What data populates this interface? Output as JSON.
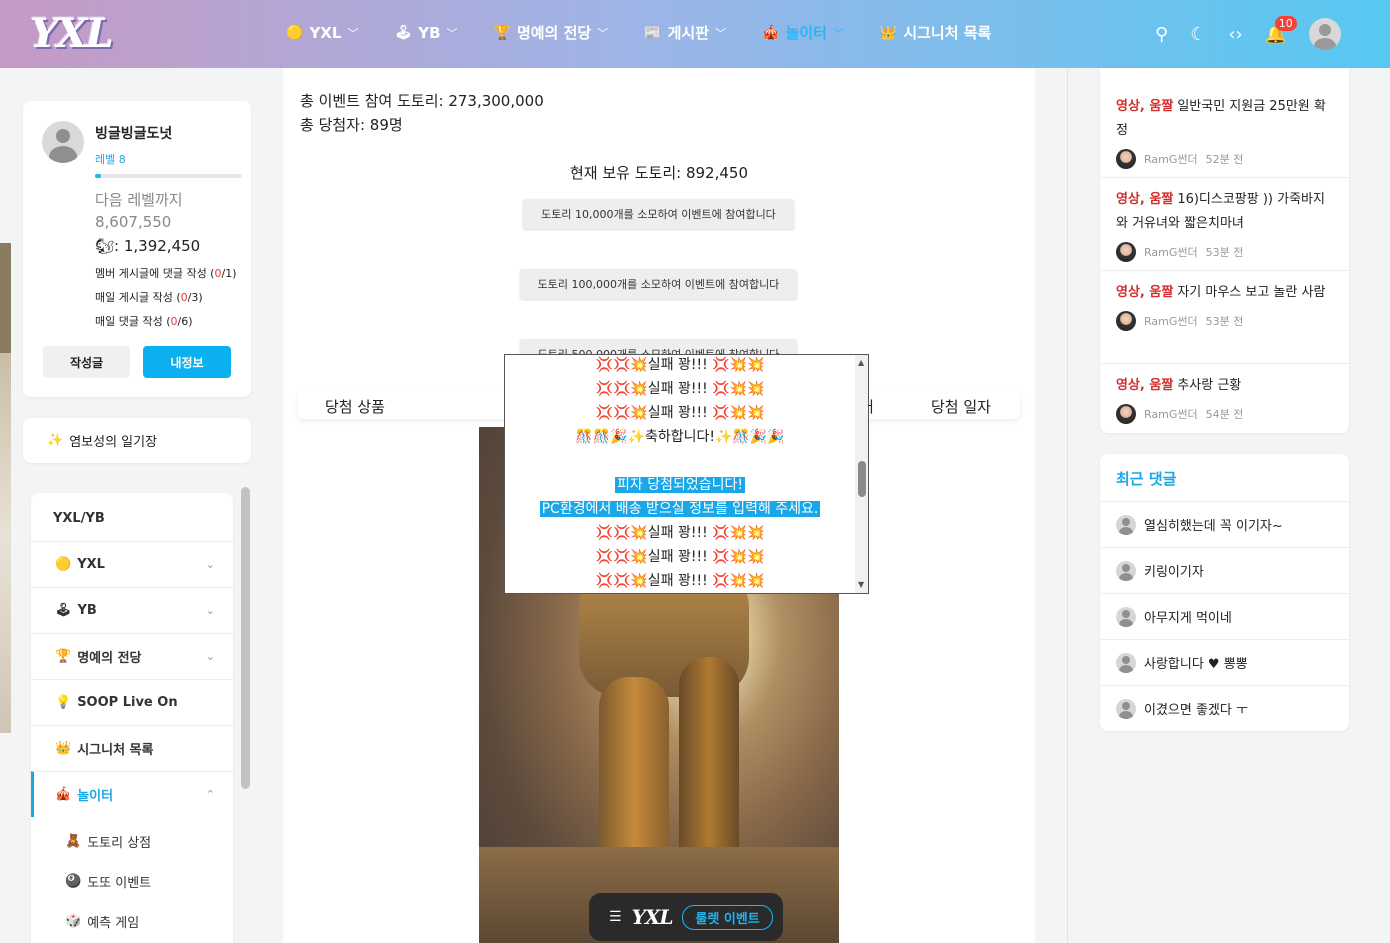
{
  "header": {
    "logo": "YXL",
    "nav": [
      {
        "icon": "🟡",
        "label": "YXL",
        "chevron": true,
        "active": false
      },
      {
        "icon": "🕹",
        "label": "YB",
        "chevron": true,
        "active": false
      },
      {
        "icon": "🏆",
        "label": "명예의 전당",
        "chevron": true,
        "active": false
      },
      {
        "icon": "📰",
        "label": "게시판",
        "chevron": true,
        "active": false
      },
      {
        "icon": "🎪",
        "label": "놀이터",
        "chevron": true,
        "active": true
      },
      {
        "icon": "👑",
        "label": "시그니처 목록",
        "chevron": false,
        "active": false
      }
    ],
    "icons": {
      "search": "⚲",
      "theme": "☾",
      "code": "‹›",
      "bell": "🔔",
      "avatar": "user-avatar"
    },
    "notification_count": "10"
  },
  "profile": {
    "name": "빙글빙글도넛",
    "level": "레벨 8",
    "progress": 0.04,
    "next_label": "다음 레벨까지",
    "next_value": "8,607,550",
    "acorn_icon": "🐿",
    "acorns": ": 1,392,450",
    "tasks": [
      {
        "label": "멤버 게시글에 댓글 작성 (",
        "value": "0",
        "total": "/1)"
      },
      {
        "label": "매일 게시글 작성 (",
        "value": "0",
        "total": "/3)"
      },
      {
        "label": "매일 댓글 작성 (",
        "value": "0",
        "total": "/6)"
      }
    ],
    "write_button": "작성글",
    "info_button": "내정보"
  },
  "diary": {
    "icon": "✨",
    "label": "염보성의 일기장"
  },
  "menu": {
    "heading": "YXL/YB",
    "items": [
      {
        "icon": "🟡",
        "label": "YXL",
        "chevron": "⌄",
        "active": false
      },
      {
        "icon": "🕹",
        "label": "YB",
        "chevron": "⌄",
        "active": false
      },
      {
        "icon": "🏆",
        "label": "명예의 전당",
        "chevron": "⌄",
        "active": false
      },
      {
        "icon": "💡",
        "label": "SOOP Live On",
        "chevron": "",
        "active": false
      },
      {
        "icon": "👑",
        "label": "시그니처 목록",
        "chevron": "",
        "active": false
      },
      {
        "icon": "🎪",
        "label": "놀이터",
        "chevron": "⌃",
        "active": true
      }
    ],
    "sub_items": [
      {
        "icon": "🧸",
        "label": "도토리 상점"
      },
      {
        "icon": "🎱",
        "label": "도또 이벤트"
      },
      {
        "icon": "🎲",
        "label": "예측 게임"
      }
    ]
  },
  "main": {
    "total_acorns": "총 이벤트 참여 도토리: 273,300,000",
    "total_winners": "총 당첨자: 89명",
    "current_acorns": "현재 보유 도토리: 892,450",
    "buttons": [
      "도토리 10,000개를 소모하여 이벤트에 참여합니다",
      "도토리 100,000개를 소모하여 이벤트에 참여합니다",
      "도토리 500,000개를 소모하여 이벤트에 참여합니다"
    ],
    "table_headers": [
      "당첨 상품",
      "상태",
      "당첨 일자"
    ],
    "popup_lines": [
      {
        "text": "💢💢💥실패 꽝!!! 💢💥💥",
        "highlight": false
      },
      {
        "text": "💢💢💥실패 꽝!!! 💢💥💥",
        "highlight": false
      },
      {
        "text": "💢💢💥실패 꽝!!! 💢💥💥",
        "highlight": false
      },
      {
        "text": "🎊🎊🎉✨축하합니다!✨🎊🎉🎉",
        "highlight": false
      },
      {
        "text": "",
        "highlight": false
      },
      {
        "text": "피자 당첨되었습니다!",
        "highlight": true
      },
      {
        "text": "PC환경에서 배송 받으실 정보를 입력해 주세요.",
        "highlight": true
      },
      {
        "text": "💢💢💥실패 꽝!!! 💢💥💥",
        "highlight": false
      },
      {
        "text": "💢💢💥실패 꽝!!! 💢💥💥",
        "highlight": false
      },
      {
        "text": "💢💢💥실패 꽝!!! 💢💥💥",
        "highlight": false
      }
    ],
    "bottom_bar": {
      "menu_icon": "☰",
      "logo": "YXL",
      "button": "룰렛 이벤트"
    }
  },
  "right": {
    "posts": [
      {
        "category": "영상, 움짤",
        "title": "일반국민 지원금 25만원 확정",
        "author": "RamG썬더",
        "time": "52분 전"
      },
      {
        "category": "영상, 움짤",
        "title": "16)디스코팡팡 )) 가죽바지와 거유녀와 짧은치마녀",
        "author": "RamG썬더",
        "time": "53분 전"
      },
      {
        "category": "영상, 움짤",
        "title": "자기 마우스 보고 놀란 사람",
        "author": "RamG썬더",
        "time": "53분 전"
      },
      {
        "category": "영상, 움짤",
        "title": "추사랑 근황",
        "author": "RamG썬더",
        "time": "54분 전"
      }
    ],
    "recent_title": "최근 댓글",
    "comments": [
      "열심히했는데 꼭 이기자~",
      "키링이기자",
      "아무지게 먹이네",
      "사랑합니다 ♥ 뽕뽕",
      "이겼으면 좋겠다 ㅜ"
    ]
  }
}
